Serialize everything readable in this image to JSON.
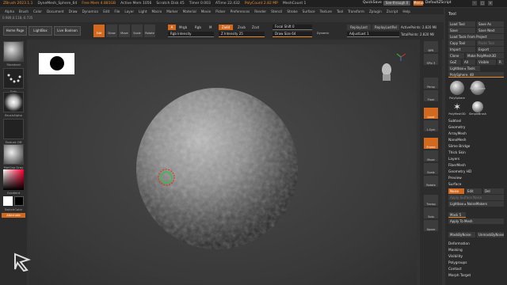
{
  "titlebar": {
    "app": "ZBrush 2023.1.1",
    "document": "DyneMesh_Sphere_64",
    "free_mem": "Free Mem 4.881GB",
    "active_mem": "Active Mem 1056",
    "scratch_disk": "Scratch Disk 45",
    "timer": "Timer 0.003",
    "atime": "ATime 22.432",
    "polycount": "PolyCount 2.82 MP",
    "meshcount": "MeshCount 1"
  },
  "top_right": {
    "quicksave": "QuickSave",
    "seethrough": "See-through 0",
    "menus": "Menus",
    "default_script": "DefaultZScript"
  },
  "menubar": [
    "Alpha",
    "Brush",
    "Color",
    "Document",
    "Draw",
    "Dynamics",
    "Edit",
    "File",
    "Layer",
    "Light",
    "Macro",
    "Marker",
    "Material",
    "Movie",
    "Picker",
    "Preferences",
    "Render",
    "Stencil",
    "Stroke",
    "Surface",
    "Texture",
    "Tool",
    "Transform",
    "Zplugin",
    "Zscript",
    "Help"
  ],
  "info_line": "0.989,0.118,-0.735",
  "shelf": {
    "home_page": "Home Page",
    "lightbox": "LightBox",
    "live_boolean": "Live Boolean",
    "edit": "Edit",
    "draw": "Draw",
    "move": "Move",
    "scale": "Scale",
    "rotate": "Rotate",
    "a_label": "A",
    "mrgb": "Mrgb",
    "rgb": "Rgb",
    "m": "M",
    "zadd": "Zadd",
    "zsub": "Zsub",
    "zcut": "Zcut",
    "rgb_intensity": "Rgb Intensity",
    "z_intensity": "Z Intensity 25",
    "focal_shift": "Focal Shift 0",
    "draw_size": "Draw Size 64",
    "dynamic": "Dynamic",
    "replay_last": "ReplayLast",
    "replay_last_rel": "ReplayLastRel",
    "adjust_last": "AdjustLast 1",
    "active_points": "ActivePoints: 2.820 Mil",
    "total_points": "TotalPoints: 2.820 Mil"
  },
  "left_shelf": {
    "brush": "Standard",
    "stroke": "Dots",
    "alpha": "BrushAlpha",
    "texture": "Texture Off",
    "material": "MatCap Gray",
    "gradient": "Gradient",
    "switch_color": "SwitchColor",
    "alternate": "Alternate"
  },
  "right_shelf": [
    "BPR",
    "SPix 3",
    "Persp",
    "Floor",
    "Local",
    "L.Sym",
    "Frame",
    "Move",
    "Scale",
    "Rotate",
    "Transp",
    "Solo",
    "Xpose"
  ],
  "tool_panel": {
    "title": "Tool",
    "load_tool": "Load Tool",
    "save_as": "Save As",
    "save": "Save",
    "save_next": "Save Next",
    "load_tools_from_project": "Load Tools From Project",
    "copy_tool": "Copy Tool",
    "paste_tool": "Paste Tool",
    "import": "Import",
    "export": "Export",
    "clone": "Clone",
    "make_polymesh3d": "Make PolyMesh3D",
    "goz": "GoZ",
    "all": "All",
    "visible": "Visible",
    "r": "R",
    "lightbox_tools": "Lightbox ▸ Tools",
    "polysphere": "PolySphere. 48",
    "thumb1": "PolySphere",
    "thumb2": "PolySphere",
    "thumb3": "PolyMesh3D",
    "thumb4": "SimpleBrush",
    "sections": [
      "Subtool",
      "Geometry",
      "ArrayMesh",
      "NanoMesh",
      "Slime Bridge",
      "Thick Skin",
      "Layers",
      "FiberMesh",
      "Geometry HD",
      "Preview",
      "Surface"
    ],
    "noise": "Noise",
    "edit": "Edit",
    "del": "Del",
    "apply_surface_noise": "Apply Surface Noise",
    "lightbox_noisemakers": "Lightbox ▸ NoiseMakers",
    "mask": "Mask",
    "mask_value": "5",
    "apply_to_mesh": "Apply To Mesh",
    "mask_by_noise": "MaskByNoise",
    "unmask_by_noise": "UnmaskByNoise",
    "sections2": [
      "Deformation",
      "Masking",
      "Visibility",
      "Polygroups",
      "Contact",
      "Morph Target"
    ]
  },
  "colors": {
    "accent": "#e88a2c",
    "panel": "#2a2a2a",
    "canvas": "#3b3b3b"
  }
}
